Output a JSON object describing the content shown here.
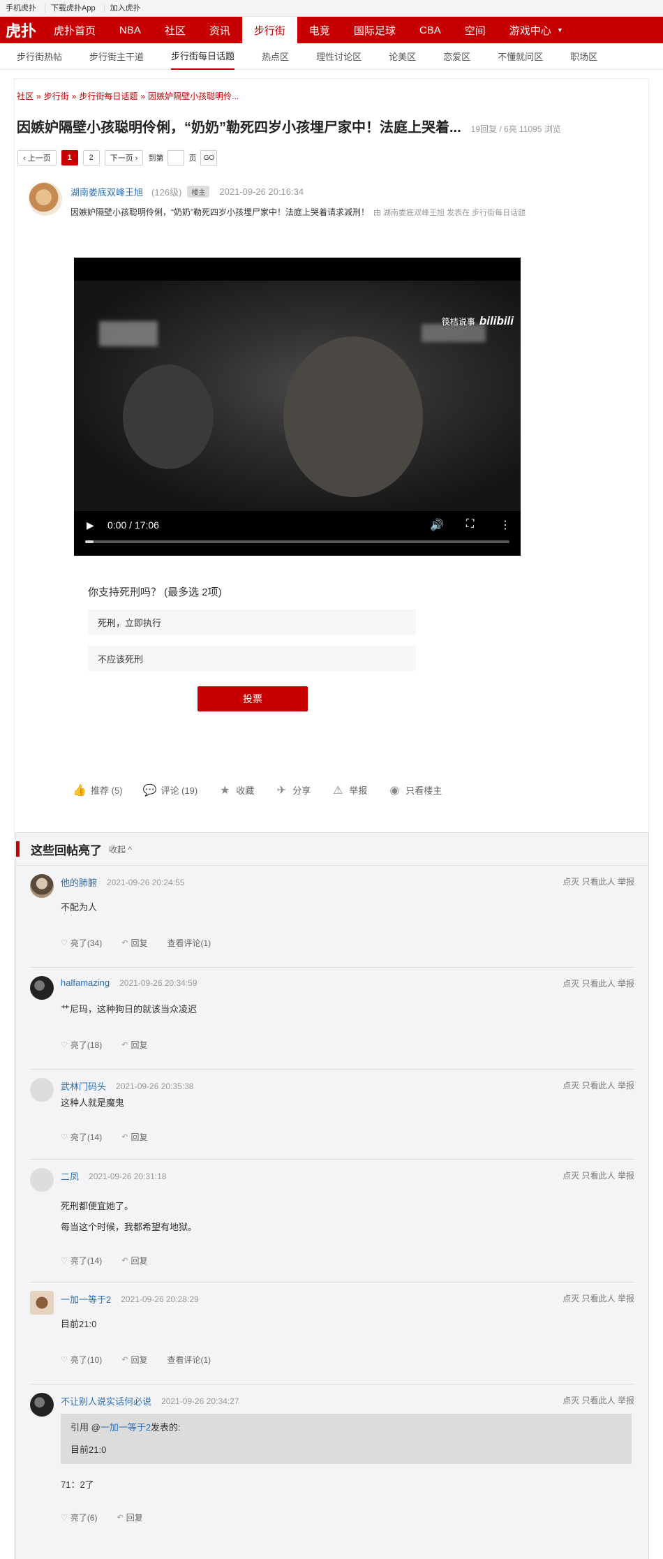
{
  "topbar": {
    "links": [
      "手机虎扑",
      "下载虎扑App",
      "加入虎扑"
    ]
  },
  "nav": {
    "logo": "虎扑",
    "items": [
      "虎扑首页",
      "NBA",
      "社区",
      "资讯",
      "步行街",
      "电竞",
      "国际足球",
      "CBA",
      "空间",
      "游戏中心"
    ],
    "active_index": 4
  },
  "subnav": {
    "items": [
      "步行街热帖",
      "步行街主干道",
      "步行街每日话题",
      "热点区",
      "理性讨论区",
      "论美区",
      "恋爱区",
      "不懂就问区",
      "职场区"
    ],
    "active_index": 2
  },
  "breadcrumb": [
    "社区",
    "步行街",
    "步行街每日话题",
    "因嫉妒隔壁小孩聪明伶..."
  ],
  "breadcrumb_sep": "»",
  "thread": {
    "title": "因嫉妒隔壁小孩聪明伶俐，“奶奶”勒死四岁小孩埋尸家中！法庭上哭着...",
    "meta": "19回复 / 6亮 11095 浏览"
  },
  "pager": {
    "prev": "‹ 上一页",
    "pages": [
      "1",
      "2"
    ],
    "current": "1",
    "next": "下一页 ›",
    "goto_prefix": "到第",
    "goto_suffix": "页",
    "go": "GO"
  },
  "op": {
    "username": "湖南娄底双峰王旭",
    "level": "(126级)",
    "badge": "楼主",
    "time": "2021-09-26 20:16:34",
    "text": "因嫉妒隔壁小孩聪明伶俐，“奶奶”勒死四岁小孩埋尸家中！法庭上哭着请求减刑！",
    "meta": "由 湖南娄底双峰王旭 发表在 步行街每日话题"
  },
  "video": {
    "watermark": "筷桔说事",
    "watermark_brand": "bilibili",
    "time": "0:00 / 17:06",
    "progress": 0.02
  },
  "poll": {
    "question": "你支持死刑吗？ (最多选 2项)",
    "options": [
      "死刑，立即执行",
      "不应该死刑"
    ],
    "vote": "投票"
  },
  "actions": {
    "recommend": "推荐 (5)",
    "comment": "评论 (19)",
    "favorite": "收藏",
    "share": "分享",
    "report": "举报",
    "only_op": "只看楼主"
  },
  "replies_section": {
    "title": "这些回帖亮了",
    "collapse": "收起 ^",
    "tools": [
      "点灭",
      "只看此人",
      "举报"
    ],
    "reply_label": "回复",
    "view_comments_label": "查看评论(1)",
    "items": [
      {
        "user": "他的肺腑",
        "time": "2021-09-26 20:24:55",
        "lines": [
          "不配为人"
        ],
        "light": "亮了(34)"
      },
      {
        "user": "halfamazing",
        "time": "2021-09-26 20:34:59",
        "lines": [
          "艹尼玛，这种狗日的就该当众凌迟"
        ],
        "light": "亮了(18)"
      },
      {
        "user": "武林门码头",
        "time": "2021-09-26 20:35:38",
        "lines": [
          "这种人就是魔鬼"
        ],
        "light": "亮了(14)"
      },
      {
        "user": "二凤",
        "time": "2021-09-26 20:31:18",
        "lines": [
          "死刑都便宜她了。",
          "每当这个时候，我都希望有地狱。"
        ],
        "light": "亮了(14)"
      },
      {
        "user": "一加一等于2",
        "time": "2021-09-26 20:28:29",
        "lines": [
          "目前21:0"
        ],
        "light": "亮了(10)"
      },
      {
        "user": "不让别人说实话何必说",
        "time": "2021-09-26 20:34:27",
        "quote_prefix": "引用 @",
        "quote_user": "一加一等于2",
        "quote_suffix": "发表的:",
        "quote_text": "目前21:0",
        "lines": [
          "71：2了"
        ],
        "light": "亮了(6)"
      }
    ]
  }
}
